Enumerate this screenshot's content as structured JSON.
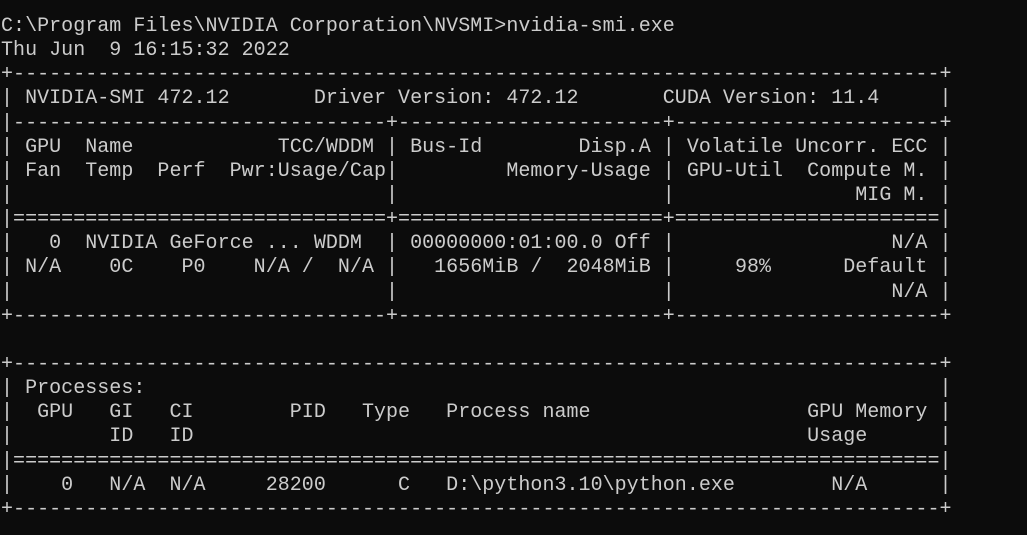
{
  "terminal": {
    "foreground": "#cccccc",
    "background": "#0c0c0c",
    "lines": [
      "C:\\Program Files\\NVIDIA Corporation\\NVSMI>nvidia-smi.exe",
      "Thu Jun  9 16:15:32 2022",
      "+-----------------------------------------------------------------------------+",
      "| NVIDIA-SMI 472.12       Driver Version: 472.12       CUDA Version: 11.4     |",
      "|-------------------------------+----------------------+----------------------+",
      "| GPU  Name            TCC/WDDM | Bus-Id        Disp.A | Volatile Uncorr. ECC |",
      "| Fan  Temp  Perf  Pwr:Usage/Cap|         Memory-Usage | GPU-Util  Compute M. |",
      "|                               |                      |               MIG M. |",
      "|===============================+======================+======================|",
      "|   0  NVIDIA GeForce ... WDDM  | 00000000:01:00.0 Off |                  N/A |",
      "| N/A    0C    P0    N/A /  N/A |   1656MiB /  2048MiB |     98%      Default |",
      "|                               |                      |                  N/A |",
      "+-------------------------------+----------------------+----------------------+",
      "",
      "+-----------------------------------------------------------------------------+",
      "| Processes:                                                                  |",
      "|  GPU   GI   CI        PID   Type   Process name                  GPU Memory |",
      "|        ID   ID                                                   Usage      |",
      "|=============================================================================|",
      "|    0   N/A  N/A     28200      C   D:\\python3.10\\python.exe        N/A      |",
      "+-----------------------------------------------------------------------------+"
    ]
  }
}
